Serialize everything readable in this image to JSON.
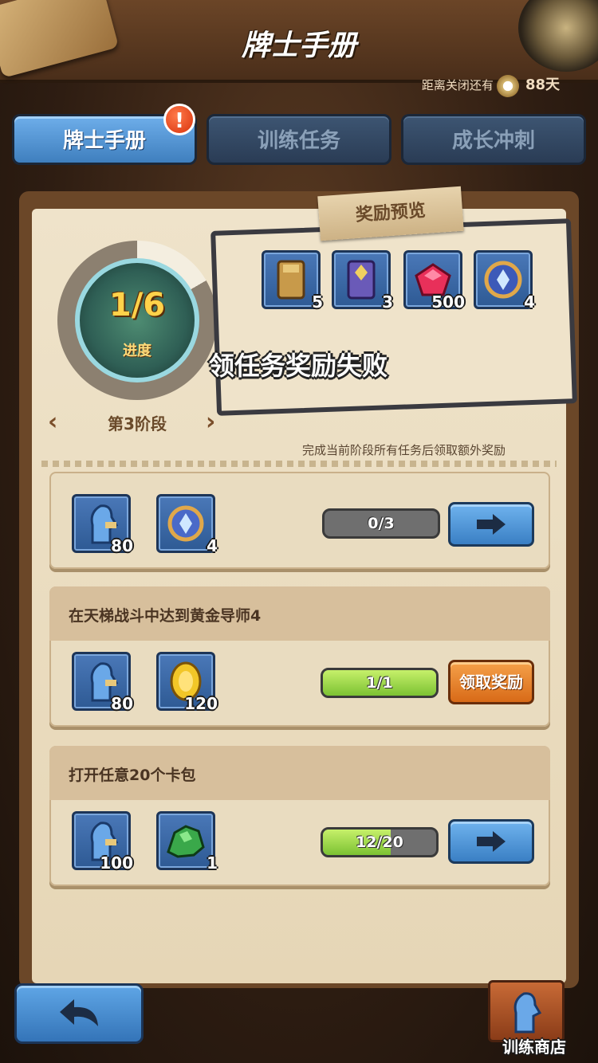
{
  "header": {
    "title": "牌士手册",
    "countdown_label": "距离关闭还有",
    "countdown_days": "88天"
  },
  "tabs": [
    {
      "label": "牌士手册",
      "active": true,
      "alert": "!"
    },
    {
      "label": "训练任务",
      "active": false
    },
    {
      "label": "成长冲刺",
      "active": false
    }
  ],
  "progress": {
    "value": "1/6",
    "label": "进度",
    "fraction": 0.1667,
    "stage": "第3阶段"
  },
  "reward_preview": {
    "title": "奖励预览",
    "items": [
      {
        "icon": "gold-card-pack-icon",
        "count": "5"
      },
      {
        "icon": "purple-card-pack-icon",
        "count": "3"
      },
      {
        "icon": "ruby-gem-icon",
        "count": "500"
      },
      {
        "icon": "crystal-orb-icon",
        "count": "4"
      }
    ]
  },
  "toast": "领任务奖励失败",
  "hint": "完成当前阶段所有任务后领取额外奖励",
  "tasks": [
    {
      "title": "",
      "rewards": [
        {
          "icon": "trainer-xp-icon",
          "count": "80"
        },
        {
          "icon": "crystal-orb-icon",
          "count": "4"
        }
      ],
      "progress_text": "0/3",
      "progress_fraction": 0.0,
      "action": "go"
    },
    {
      "title": "在天梯战斗中达到黄金导师4",
      "rewards": [
        {
          "icon": "trainer-xp-icon",
          "count": "80"
        },
        {
          "icon": "gold-coin-icon",
          "count": "120"
        }
      ],
      "progress_text": "1/1",
      "progress_fraction": 1.0,
      "action": "claim",
      "action_label": "领取奖励"
    },
    {
      "title": "打开任意20个卡包",
      "rewards": [
        {
          "icon": "trainer-xp-icon",
          "count": "100"
        },
        {
          "icon": "green-ore-icon",
          "count": "1"
        }
      ],
      "progress_text": "12/20",
      "progress_fraction": 0.6,
      "action": "go"
    }
  ],
  "footer": {
    "shop_label": "训练商店"
  },
  "colors": {
    "accent_blue": "#4a8fd4",
    "claim_orange": "#e07a26",
    "progress_green": "#9ad84a",
    "parchment": "#efe3ca"
  }
}
